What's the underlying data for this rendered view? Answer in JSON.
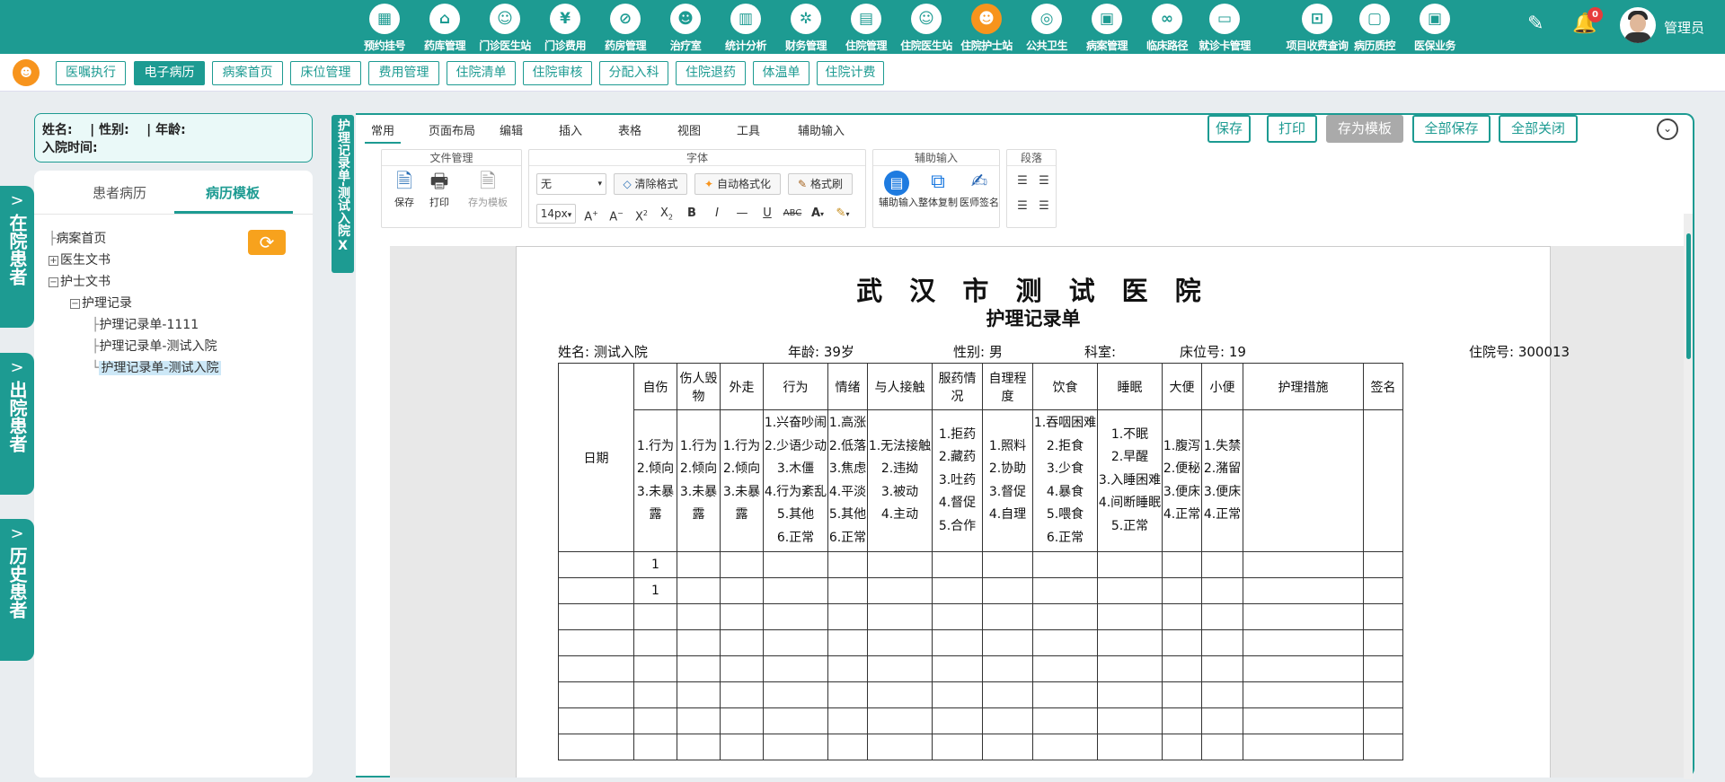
{
  "topnav": {
    "items": [
      {
        "label": "预约挂号",
        "icon": "calendar-icon",
        "glyph": "▦"
      },
      {
        "label": "药库管理",
        "icon": "warehouse-icon",
        "glyph": "⌂"
      },
      {
        "label": "门诊医生站",
        "icon": "doctor-icon",
        "glyph": "☺"
      },
      {
        "label": "门诊费用",
        "icon": "yen-icon",
        "glyph": "¥"
      },
      {
        "label": "药房管理",
        "icon": "pill-icon",
        "glyph": "⊘"
      },
      {
        "label": "治疗室",
        "icon": "nurse-icon",
        "glyph": "☻"
      },
      {
        "label": "统计分析",
        "icon": "chart-icon",
        "glyph": "▥"
      },
      {
        "label": "财务管理",
        "icon": "gear-icon",
        "glyph": "✲"
      },
      {
        "label": "住院管理",
        "icon": "bed-icon",
        "glyph": "▤"
      },
      {
        "label": "住院医生站",
        "icon": "inpatient-doctor-icon",
        "glyph": "☺"
      },
      {
        "label": "住院护士站",
        "icon": "nurse-station-icon",
        "glyph": "☻"
      },
      {
        "label": "公共卫生",
        "icon": "target-icon",
        "glyph": "◎"
      },
      {
        "label": "病案管理",
        "icon": "record-icon",
        "glyph": "▣"
      },
      {
        "label": "临床路径",
        "icon": "path-icon",
        "glyph": "∞"
      },
      {
        "label": "就诊卡管理",
        "icon": "card-icon",
        "glyph": "▭"
      },
      {
        "label": "项目收费查询",
        "icon": "fee-search-icon",
        "glyph": "⊡"
      },
      {
        "label": "病历质控",
        "icon": "quality-icon",
        "glyph": "▢"
      },
      {
        "label": "医保业务",
        "icon": "insurance-icon",
        "glyph": "▣"
      }
    ],
    "active_index": 10,
    "notification_count": "0",
    "username": "管理员"
  },
  "subnav": {
    "items": [
      "医嘱执行",
      "电子病历",
      "病案首页",
      "床位管理",
      "费用管理",
      "住院清单",
      "住院审核",
      "分配入科",
      "住院退药",
      "体温单",
      "住院计费"
    ],
    "active_index": 1
  },
  "sidebar_tabs": [
    {
      "label": "在院患者"
    },
    {
      "label": "出院患者"
    },
    {
      "label": "历史患者"
    }
  ],
  "patient_info": {
    "line1": "姓名:    | 性别:    | 年龄:",
    "line2": "入院时间:"
  },
  "left_panel": {
    "tabs": [
      "患者病历",
      "病历模板"
    ],
    "active_tab": 1,
    "tree": [
      {
        "label": "病案首页",
        "prefix": "├"
      },
      {
        "label": "医生文书",
        "prefix": "+"
      },
      {
        "label": "护士文书",
        "prefix": "−"
      },
      {
        "label": "护理记录",
        "prefix": "−"
      },
      {
        "label": "护理记录单-1111",
        "prefix": "├"
      },
      {
        "label": "护理记录单-测试入院",
        "prefix": "├"
      },
      {
        "label": "护理记录单-测试入院",
        "prefix": "└"
      }
    ]
  },
  "doc_tag": {
    "label": "护理记录单-测试入院",
    "close": "X"
  },
  "editor": {
    "menu_tabs": [
      "常用",
      "页面布局",
      "编辑",
      "插入",
      "表格",
      "视图",
      "工具",
      "辅助输入"
    ],
    "active_menu": 0,
    "top_buttons": [
      "保存",
      "打印",
      "存为模板",
      "全部保存",
      "全部关闭"
    ],
    "groups": {
      "file": {
        "title": "文件管理",
        "buttons": [
          "保存",
          "打印",
          "存为模板"
        ]
      },
      "font": {
        "title": "字体",
        "font_name": "无",
        "font_size": "14px",
        "clear_format": "清除格式",
        "auto_format": "自动格式化",
        "format_brush": "格式刷"
      },
      "assist": {
        "title": "辅助输入",
        "buttons": [
          "辅助输入",
          "整体复制",
          "医师签名"
        ]
      },
      "paragraph": {
        "title": "段落"
      }
    }
  },
  "document": {
    "hospital": "武 汉 市 测 试 医 院",
    "form_title": "护理记录单",
    "name": "姓名: 测试入院",
    "age": "年龄: 39岁",
    "gender": "性别: 男",
    "dept": "科室:",
    "bed": "床位号: 19",
    "admission_no": "住院号: 300013",
    "table": {
      "date_header": "日期",
      "columns": [
        "自伤",
        "伤人毁物",
        "外走",
        "行为",
        "情绪",
        "与人接触",
        "服药情况",
        "自理程度",
        "饮食",
        "睡眠",
        "大便",
        "小便",
        "护理措施",
        "签名"
      ],
      "options": [
        [
          "1.行为",
          "2.倾向",
          "3.未暴",
          "露"
        ],
        [
          "1.行为",
          "2.倾向",
          "3.未暴",
          "露"
        ],
        [
          "1.行为",
          "2.倾向",
          "3.未暴",
          "露"
        ],
        [
          "1.兴奋吵闹",
          "2.少语少动",
          "3.木僵",
          "4.行为紊乱",
          "5.其他",
          "6.正常"
        ],
        [
          "1.高涨",
          "2.低落",
          "3.焦虑",
          "4.平淡",
          "5.其他",
          "6.正常"
        ],
        [
          "1.无法接触",
          "2.违拗",
          "3.被动",
          "4.主动"
        ],
        [
          "1.拒药",
          "2.藏药",
          "3.吐药",
          "4.督促",
          "5.合作"
        ],
        [
          "1.照料",
          "2.协助",
          "3.督促",
          "4.自理"
        ],
        [
          "1.吞咽困难",
          "2.拒食",
          "3.少食",
          "4.暴食",
          "5.喂食",
          "6.正常"
        ],
        [
          "1.不眠",
          "2.早醒",
          "3.入睡困难",
          "4.间断睡眠",
          "5.正常"
        ],
        [
          "1.腹泻",
          "2.便秘",
          "3.便床",
          "4.正常"
        ],
        [
          "1.失禁",
          "2.潴留",
          "3.便床",
          "4.正常"
        ],
        [],
        []
      ],
      "rows": [
        {
          "col1": "1"
        },
        {
          "col1": "1"
        },
        {
          "col1": ""
        },
        {
          "col1": ""
        },
        {
          "col1": ""
        },
        {
          "col1": ""
        },
        {
          "col1": ""
        },
        {
          "col1": ""
        }
      ]
    }
  },
  "colors": {
    "primary": "#1d9b92",
    "accent": "#f7941d",
    "badge": "#e63c3c"
  }
}
